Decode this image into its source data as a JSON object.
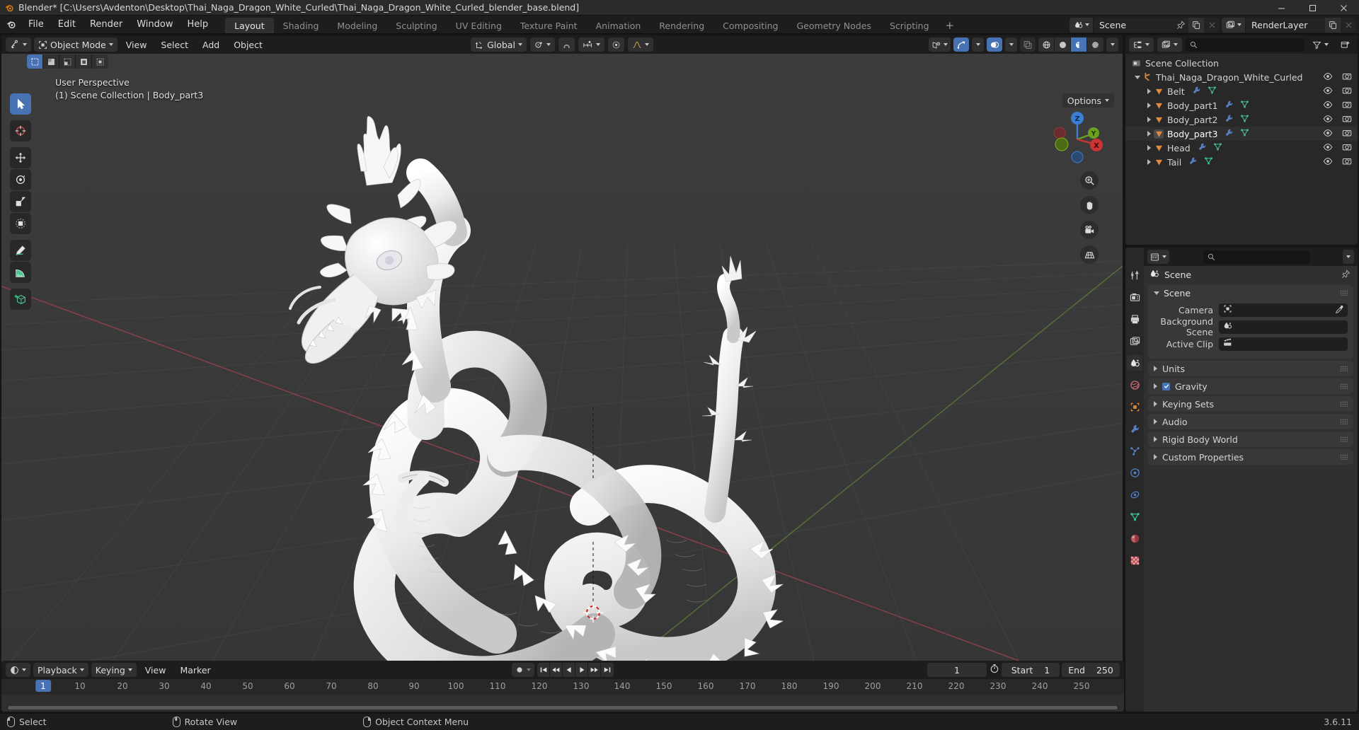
{
  "window": {
    "title": "Blender* [C:\\Users\\Avdenton\\Desktop\\Thai_Naga_Dragon_White_Curled\\Thai_Naga_Dragon_White_Curled_blender_base.blend]",
    "minimize": "–",
    "maximize": "❐",
    "close": "✕"
  },
  "topbar": {
    "menus": [
      "File",
      "Edit",
      "Render",
      "Window",
      "Help"
    ],
    "workspaces": [
      {
        "label": "Layout",
        "active": true
      },
      {
        "label": "Shading",
        "active": false
      },
      {
        "label": "Modeling",
        "active": false
      },
      {
        "label": "Sculpting",
        "active": false
      },
      {
        "label": "UV Editing",
        "active": false
      },
      {
        "label": "Texture Paint",
        "active": false
      },
      {
        "label": "Animation",
        "active": false
      },
      {
        "label": "Rendering",
        "active": false
      },
      {
        "label": "Compositing",
        "active": false
      },
      {
        "label": "Geometry Nodes",
        "active": false
      },
      {
        "label": "Scripting",
        "active": false
      }
    ],
    "add_workspace": "+",
    "scene_name": "Scene",
    "viewlayer_name": "RenderLayer"
  },
  "viewport": {
    "mode": "Object Mode",
    "menus": [
      "View",
      "Select",
      "Add",
      "Object"
    ],
    "transform_orientation": "Global",
    "options_label": "Options",
    "overlay_line1": "User Perspective",
    "overlay_line2": "(1) Scene Collection | Body_part3",
    "gizmo_axes": [
      "Z",
      "Y",
      "X"
    ]
  },
  "outliner": {
    "search_placeholder": "",
    "root": "Scene Collection",
    "items": [
      {
        "label": "Thai_Naga_Dragon_White_Curled",
        "indent": 1,
        "type": "collection",
        "expanded": true,
        "selected": false,
        "modifier": false,
        "mesh": false
      },
      {
        "label": "Belt",
        "indent": 2,
        "type": "object",
        "expanded": false,
        "selected": false,
        "modifier": true,
        "mesh": true
      },
      {
        "label": "Body_part1",
        "indent": 2,
        "type": "object",
        "expanded": false,
        "selected": false,
        "modifier": true,
        "mesh": true
      },
      {
        "label": "Body_part2",
        "indent": 2,
        "type": "object",
        "expanded": false,
        "selected": false,
        "modifier": true,
        "mesh": true
      },
      {
        "label": "Body_part3",
        "indent": 2,
        "type": "object",
        "expanded": false,
        "selected": true,
        "modifier": true,
        "mesh": true
      },
      {
        "label": "Head",
        "indent": 2,
        "type": "object",
        "expanded": false,
        "selected": false,
        "modifier": true,
        "mesh": true
      },
      {
        "label": "Tail",
        "indent": 2,
        "type": "object",
        "expanded": false,
        "selected": false,
        "modifier": true,
        "mesh": true
      }
    ]
  },
  "properties": {
    "search_placeholder": "",
    "breadcrumb": "Scene",
    "scene_panel": {
      "title": "Scene",
      "rows": [
        {
          "label": "Camera",
          "value": ""
        },
        {
          "label": "Background Scene",
          "value": ""
        },
        {
          "label": "Active Clip",
          "value": ""
        }
      ]
    },
    "sections": [
      {
        "label": "Units",
        "checkbox": false
      },
      {
        "label": "Gravity",
        "checkbox": true
      },
      {
        "label": "Keying Sets",
        "checkbox": false
      },
      {
        "label": "Audio",
        "checkbox": false
      },
      {
        "label": "Rigid Body World",
        "checkbox": false
      },
      {
        "label": "Custom Properties",
        "checkbox": false
      }
    ]
  },
  "timeline": {
    "menus": [
      "Playback",
      "Keying",
      "View",
      "Marker"
    ],
    "current_frame": "1",
    "start_label": "Start",
    "start_value": "1",
    "end_label": "End",
    "end_value": "250",
    "ticks": [
      "10",
      "20",
      "30",
      "40",
      "50",
      "60",
      "70",
      "80",
      "90",
      "100",
      "110",
      "120",
      "130",
      "140",
      "150",
      "160",
      "170",
      "180",
      "190",
      "200",
      "210",
      "220",
      "230",
      "240",
      "250"
    ],
    "playhead_label": "1"
  },
  "statusbar": {
    "items": [
      "Select",
      "Rotate View",
      "Object Context Menu"
    ],
    "version": "3.6.11"
  },
  "colors": {
    "accent": "#4772b3",
    "orange": "#e08a3c",
    "green": "#3ec49a",
    "blue_modifier": "#5680c2",
    "header_bg": "#1d1d1d",
    "panel_bg": "#303030",
    "viewport_bg": "#393939"
  }
}
